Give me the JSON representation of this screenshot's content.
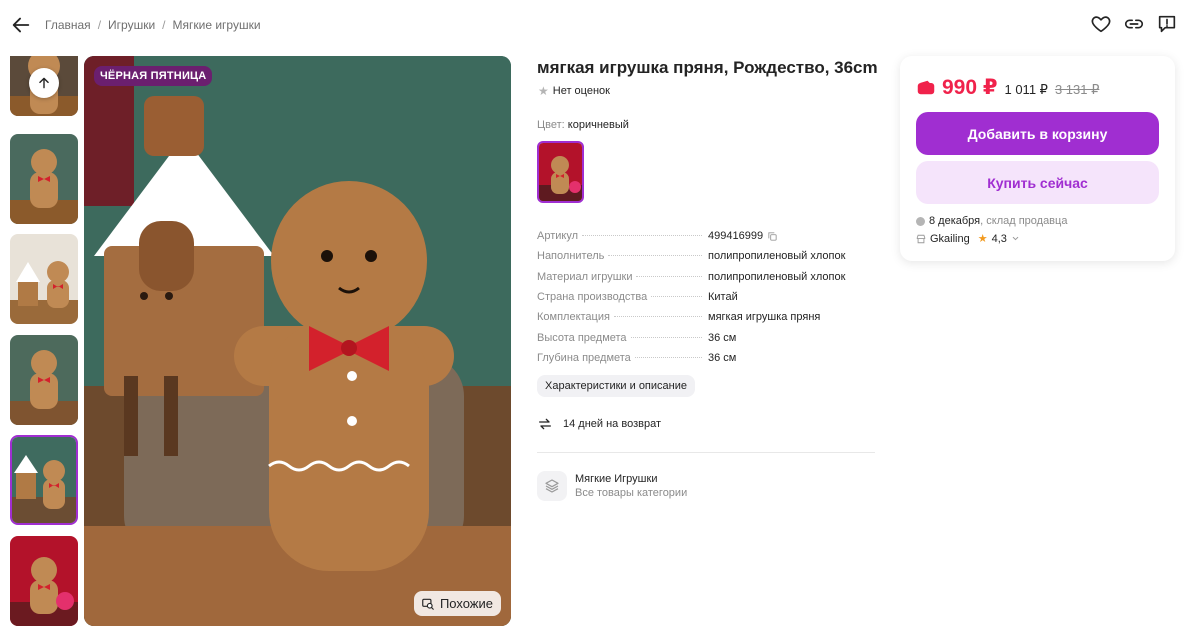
{
  "header": {
    "breadcrumbs": [
      "Главная",
      "Игрушки",
      "Мягкие игрушки"
    ],
    "separator": "/"
  },
  "gallery": {
    "promo_badge": "ЧЁРНАЯ ПЯТНИЦА",
    "similar_label": "Похожие",
    "thumb_count": 6,
    "selected_thumb": 5
  },
  "product": {
    "title": "мягкая игрушка пряня, Рождество, 36cm",
    "rating_text": "Нет оценок",
    "color_label": "Цвет:",
    "color_value": "коричневый",
    "specs": [
      {
        "key": "Артикул",
        "value": "499416999"
      },
      {
        "key": "Наполнитель",
        "value": "полипропиленовый хлопок"
      },
      {
        "key": "Материал игрушки",
        "value": "полипропиленовый хлопок"
      },
      {
        "key": "Страна производства",
        "value": "Китай"
      },
      {
        "key": "Комплектация",
        "value": "мягкая игрушка пряня"
      },
      {
        "key": "Высота предмета",
        "value": "36 см"
      },
      {
        "key": "Глубина предмета",
        "value": "36 см"
      }
    ],
    "details_chip": "Характеристики и описание",
    "return_text": "14 дней на возврат",
    "category": {
      "title": "Мягкие Игрушки",
      "subtitle": "Все товары категории"
    }
  },
  "buy_card": {
    "price": "990 ₽",
    "price_alt": "1 011 ₽",
    "price_old": "3 131 ₽",
    "add_to_cart": "Добавить в корзину",
    "buy_now": "Купить сейчас",
    "delivery_date": "8 декабря",
    "delivery_source": ", склад продавца",
    "seller": "Gkailing",
    "seller_rating": "4,3"
  },
  "colors": {
    "accent": "#a02ed1",
    "price": "#f0224b",
    "promo_bg": "#6b1f6f",
    "buy_now_bg": "#f5e4fb"
  }
}
